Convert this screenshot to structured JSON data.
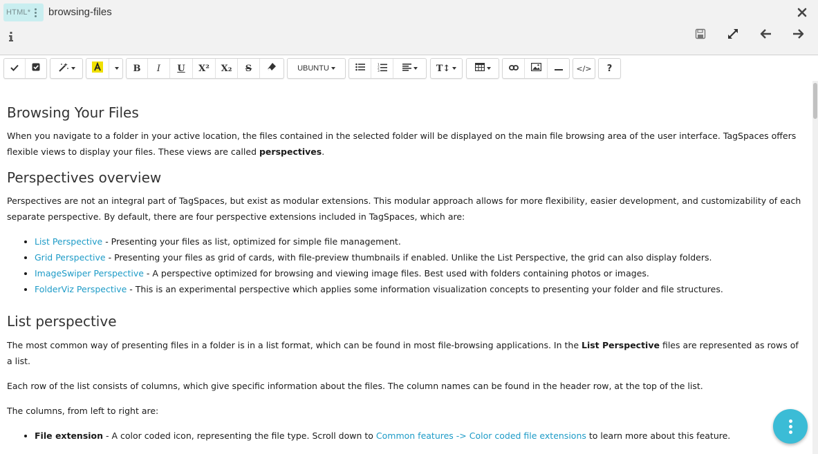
{
  "header": {
    "file_extension": "HTML*",
    "file_name": "browsing-files"
  },
  "toolbar": {
    "font_name": "UBUNTU",
    "highlight_color": "#f0e000",
    "superscript_label": "X²",
    "subscript_label": "X₂",
    "bold_label": "B",
    "italic_label": "I",
    "underline_label": "U",
    "strike_label": "S",
    "text_size_label": "T↕",
    "code_label": "</>",
    "help_label": "?"
  },
  "colors": {
    "accent": "#3bbcd6",
    "link": "#1d9bc7",
    "badge": "#c9eef0"
  },
  "icons": [
    "close-icon",
    "info-icon",
    "save-icon",
    "fullscreen-icon",
    "arrow-left-icon",
    "arrow-right-icon",
    "check-icon",
    "checkbox-icon",
    "magic-wand-icon",
    "highlight-icon",
    "eraser-icon",
    "bullet-list-icon",
    "numbered-list-icon",
    "align-icon",
    "table-icon",
    "link-icon",
    "image-icon",
    "horizontal-rule-icon",
    "more-vert-icon"
  ],
  "doc": {
    "h1": "Browsing Your Files",
    "p1_text": "When you navigate to a folder in your active location, the files contained in the selected folder will be displayed on the main file browsing area of the user interface. TagSpaces offers flexible views to display your files. These views are called ",
    "p1_bold": "perspectives",
    "p1_end": ".",
    "h2": "Perspectives overview",
    "p2": "Perspectives are not an integral part of TagSpaces, but exist as modular extensions. This modular approach allows for more flexibility, easier development, and customizability of each separate perspective. By default, there are four perspective extensions included in TagSpaces, which are:",
    "perspectives": [
      {
        "link": "List Perspective",
        "text": " - Presenting your files as list, optimized for simple file management."
      },
      {
        "link": "Grid Perspective",
        "text": " - Presenting your files as grid of cards, with file-preview thumbnails if enabled. Unlike the List Perspective, the grid can also display folders."
      },
      {
        "link": "ImageSwiper Perspective",
        "text": " - A perspective optimized for browsing and viewing image files. Best used with folders containing photos or images."
      },
      {
        "link": "FolderViz Perspective",
        "text": " - This is an experimental perspective which applies some information visualization concepts to presenting your folder and file structures."
      }
    ],
    "h3": "List perspective",
    "p3_text": "The most common way of presenting files in a folder is in a list format, which can be found in most file-browsing applications. In the ",
    "p3_bold": "List Perspective",
    "p3_end": " files are represented as rows of a list.",
    "p4": "Each row of the list consists of columns, which give specific information about the files. The column names can be found in the header row, at the top of the list.",
    "p5": "The columns, from left to right are:",
    "columns": [
      {
        "bold": "File extension",
        "text": " - A color coded icon, representing the file type. Scroll down to ",
        "link": "Common features -> Color coded file extensions",
        "end": " to learn more about this feature."
      }
    ]
  }
}
